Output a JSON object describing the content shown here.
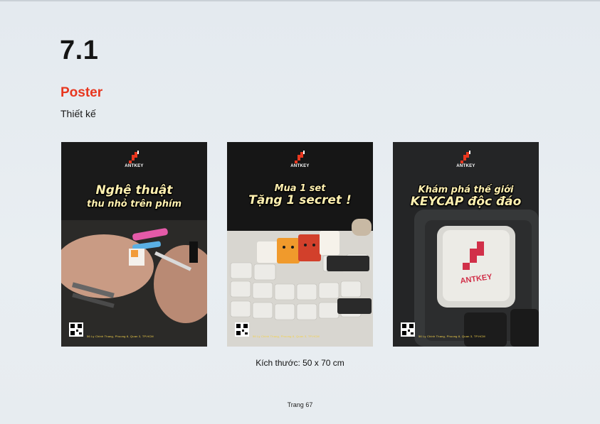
{
  "section": {
    "number": "7.1",
    "title": "Poster",
    "subtitle": "Thiết kế"
  },
  "posters": [
    {
      "headline_lines": [
        "Nghệ thuật",
        "thu nhỏ trên phím"
      ],
      "brand": "ANTKEY",
      "address": "56 Ly Chinh Thang, Phuong 8, Quan 3, TP.HCM"
    },
    {
      "headline_lines": [
        "Mua 1 set",
        "Tặng 1 secret !"
      ],
      "brand": "ANTKEY",
      "address": "56 Ly Chinh Thang, Phuong 8, Quan 3, TP.HCM"
    },
    {
      "headline_lines": [
        "Khám phá thế giới",
        "KEYCAP độc đáo"
      ],
      "brand": "ANTKEY",
      "address": "56 Ly Chinh Thang, Phuong 8, Quan 3, TP.HCM"
    }
  ],
  "caption": "Kích thước: 50 x 70 cm",
  "page_label": "Trang 67",
  "colors": {
    "accent": "#e8371f",
    "headline": "#fff0b0"
  }
}
